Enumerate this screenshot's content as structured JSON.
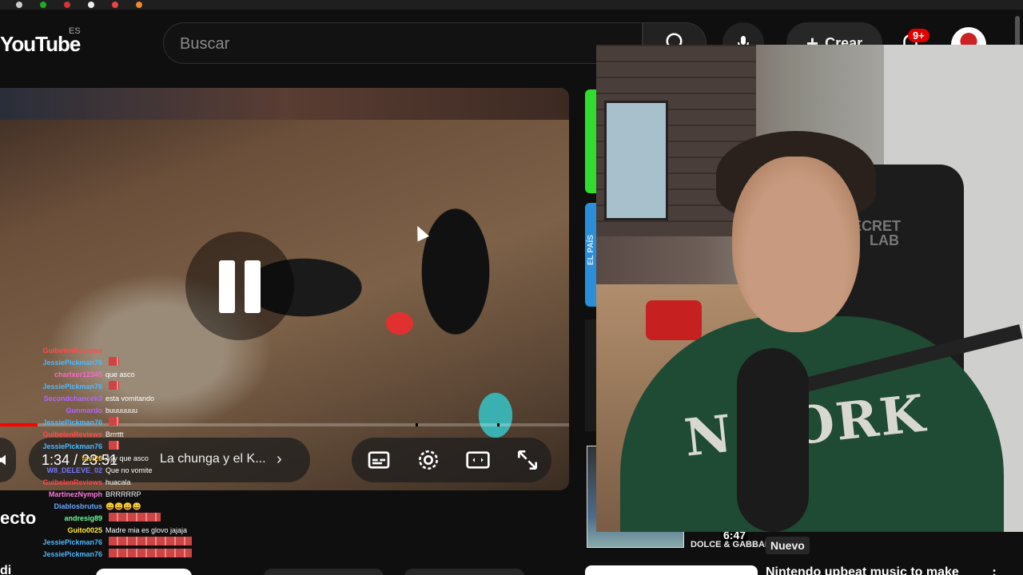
{
  "header": {
    "logo_text": "YouTube",
    "country_code": "ES",
    "search_placeholder": "Buscar",
    "create_label": "Crear",
    "notification_count": "9+"
  },
  "player": {
    "time": "1:34 / 23:51",
    "chapter_title": "La chunga y el K...",
    "progress_fraction": 0.066
  },
  "chat": [
    {
      "name": "GuibelenReviews",
      "msg": "",
      "color": "#ff4d4d"
    },
    {
      "name": "JessiePickman76",
      "msg": "",
      "color": "#4db8ff",
      "emotes": 1
    },
    {
      "name": "charlxer12345",
      "msg": "que asco",
      "color": "#ff66cc"
    },
    {
      "name": "JessiePickman76",
      "msg": "",
      "color": "#4db8ff",
      "emotes": 1
    },
    {
      "name": "Secondchancek3",
      "msg": "esta vomitando",
      "color": "#b366ff"
    },
    {
      "name": "Gunmardo",
      "msg": "buuuuuuu",
      "color": "#b366ff"
    },
    {
      "name": "JessiePickman76",
      "msg": "",
      "color": "#4db8ff",
      "emotes": 1
    },
    {
      "name": "GuibelenReviews",
      "msg": "Brrrttt",
      "color": "#ff4d4d"
    },
    {
      "name": "JessiePickman76",
      "msg": "",
      "color": "#4db8ff",
      "emotes": 1
    },
    {
      "name": "favi20",
      "msg": "Ayy que asco",
      "color": "#ffcc44"
    },
    {
      "name": "W8_DELEVE_02",
      "msg": "Que no vomite",
      "color": "#7777ff"
    },
    {
      "name": "GuibelenReviews",
      "msg": "huacala",
      "color": "#ff4d4d"
    },
    {
      "name": "MartinezNymph",
      "msg": "BRRRRRP",
      "color": "#ff77dd"
    },
    {
      "name": "Diablosbrutus",
      "msg": "😄😄😄😄",
      "color": "#66aaff"
    },
    {
      "name": "andresig89",
      "msg": "",
      "color": "#66ff99",
      "emotes": 5
    },
    {
      "name": "Guito0025",
      "msg": "Madre mia es glovo jajaja",
      "color": "#ffee44"
    },
    {
      "name": "JessiePickman76",
      "msg": "",
      "color": "#4db8ff",
      "emotes": 8
    },
    {
      "name": "JessiePickman76",
      "msg": "",
      "color": "#4db8ff",
      "emotes": 8
    }
  ],
  "below_video": {
    "title_fragment": "ecto",
    "channel_fragment": "di"
  },
  "sidebar": {
    "side_label": "EL PAÍS",
    "duration": "6:47",
    "brand_text": "DOLCE & GABBANA",
    "new_badge": "Nuevo",
    "next_title": "Nintendo upbeat music to make"
  },
  "webcam": {
    "chair_logo_line1": "ECRET",
    "chair_logo_line2": "LAB",
    "shirt_text": "N YORK"
  },
  "colors": {
    "accent_red": "#ff0000",
    "green_strip": "#2fdc2f",
    "blue_strip": "#2a8fd8"
  }
}
